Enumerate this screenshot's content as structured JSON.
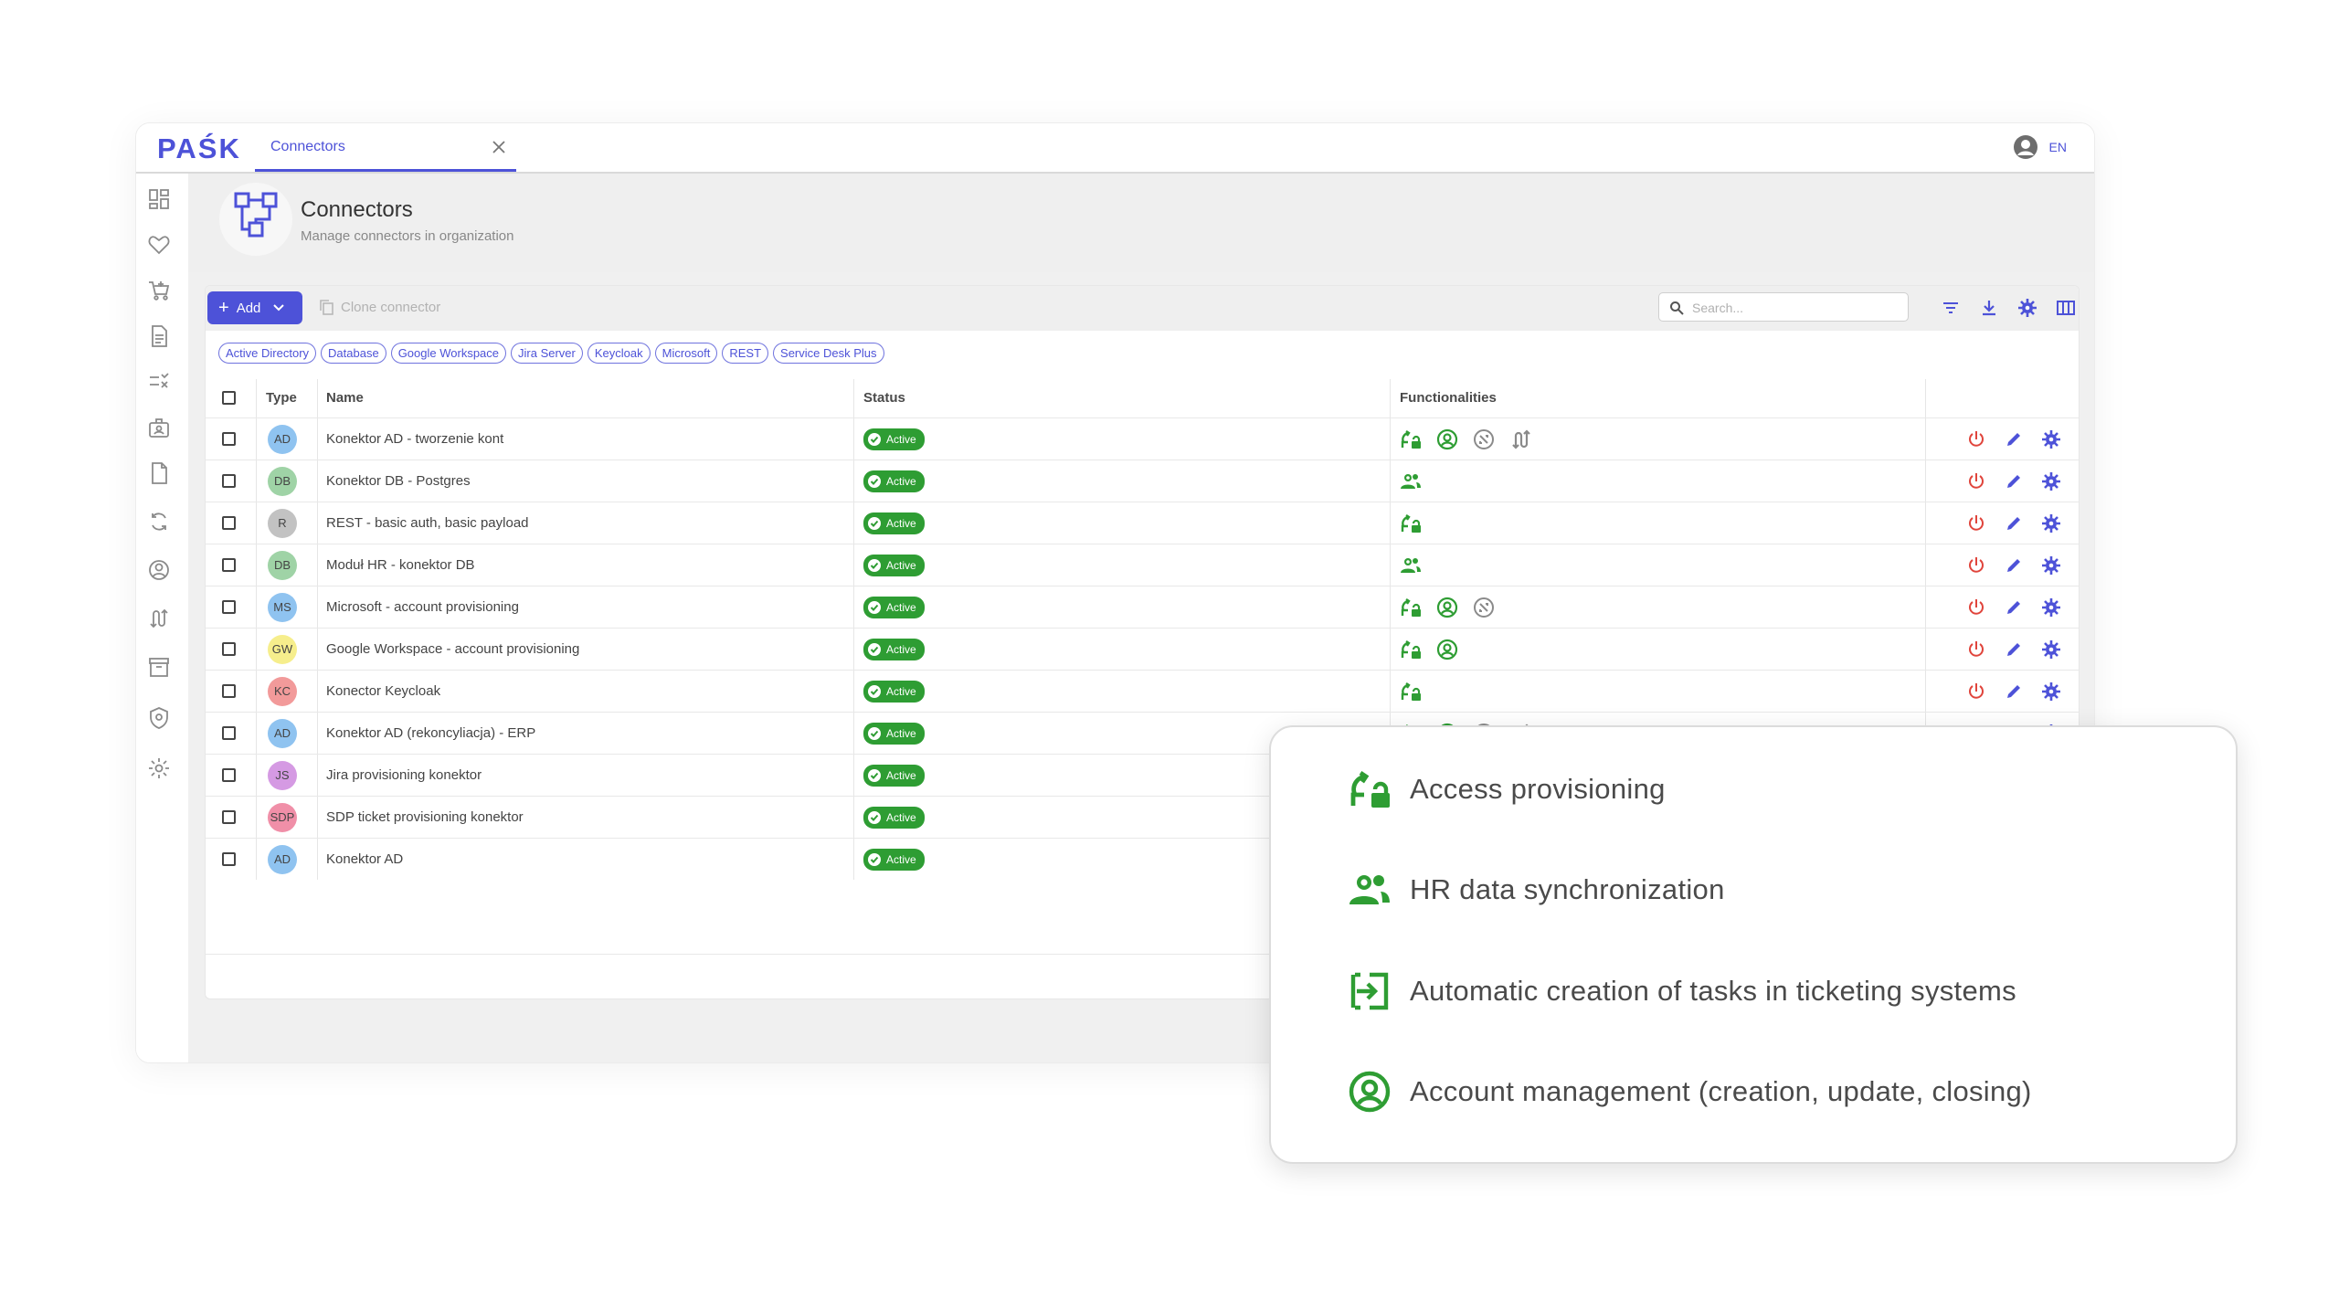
{
  "app": {
    "logo": "PAŚK",
    "tab_label": "Connectors",
    "language": "EN"
  },
  "page": {
    "title": "Connectors",
    "subtitle": "Manage connectors in organization"
  },
  "toolbar": {
    "add_label": "Add",
    "clone_label": "Clone connector",
    "search_placeholder": "Search..."
  },
  "filters": [
    "Active Directory",
    "Database",
    "Google Workspace",
    "Jira Server",
    "Keycloak",
    "Microsoft",
    "REST",
    "Service Desk Plus"
  ],
  "columns": {
    "type": "Type",
    "name": "Name",
    "status": "Status",
    "functionalities": "Functionalities"
  },
  "rows": [
    {
      "type": "AD",
      "color": "#8fc3f0",
      "name": "Konektor AD - tworzenie kont",
      "status": "Active",
      "functionalities": [
        "access-provisioning-icon",
        "account-management-icon",
        "ticketing-icon",
        "workflow-icon"
      ]
    },
    {
      "type": "DB",
      "color": "#9fd3a6",
      "name": "Konektor DB - Postgres",
      "status": "Active",
      "functionalities": [
        "hr-sync-icon"
      ]
    },
    {
      "type": "R",
      "color": "#c2c2c2",
      "name": "REST - basic auth, basic payload",
      "status": "Active",
      "functionalities": [
        "access-provisioning-icon"
      ]
    },
    {
      "type": "DB",
      "color": "#9fd3a6",
      "name": "Moduł HR - konektor DB",
      "status": "Active",
      "functionalities": [
        "hr-sync-icon"
      ]
    },
    {
      "type": "MS",
      "color": "#8fc3f0",
      "name": "Microsoft - account provisioning",
      "status": "Active",
      "functionalities": [
        "access-provisioning-icon",
        "account-management-icon",
        "ticketing-icon"
      ]
    },
    {
      "type": "GW",
      "color": "#f6ee8c",
      "name": "Google Workspace - account provisioning",
      "status": "Active",
      "functionalities": [
        "access-provisioning-icon",
        "account-management-icon"
      ]
    },
    {
      "type": "KC",
      "color": "#f29a9a",
      "name": "Konector Keycloak",
      "status": "Active",
      "functionalities": [
        "access-provisioning-icon"
      ]
    },
    {
      "type": "AD",
      "color": "#8fc3f0",
      "name": "Konektor AD (rekoncyliacja) - ERP",
      "status": "Active",
      "functionalities": [
        "access-provisioning-icon",
        "account-management-icon",
        "ticketing-icon",
        "workflow-icon"
      ]
    },
    {
      "type": "JS",
      "color": "#d59ae3",
      "name": "Jira provisioning konektor",
      "status": "Active",
      "functionalities": []
    },
    {
      "type": "SDP",
      "color": "#f08fa8",
      "name": "SDP ticket provisioning konektor",
      "status": "Active",
      "functionalities": []
    },
    {
      "type": "AD",
      "color": "#8fc3f0",
      "name": "Konektor AD",
      "status": "Active",
      "functionalities": []
    }
  ],
  "legend": [
    {
      "icon": "access-provisioning-icon",
      "label": "Access provisioning"
    },
    {
      "icon": "hr-sync-icon",
      "label": "HR data synchronization"
    },
    {
      "icon": "ticket-task-icon",
      "label": "Automatic creation of tasks in ticketing systems"
    },
    {
      "icon": "account-management-icon",
      "label": "Account management (creation, update, closing)"
    }
  ],
  "colors": {
    "accent": "#4d52d8",
    "success": "#2e9d33",
    "danger": "#e0453c"
  }
}
